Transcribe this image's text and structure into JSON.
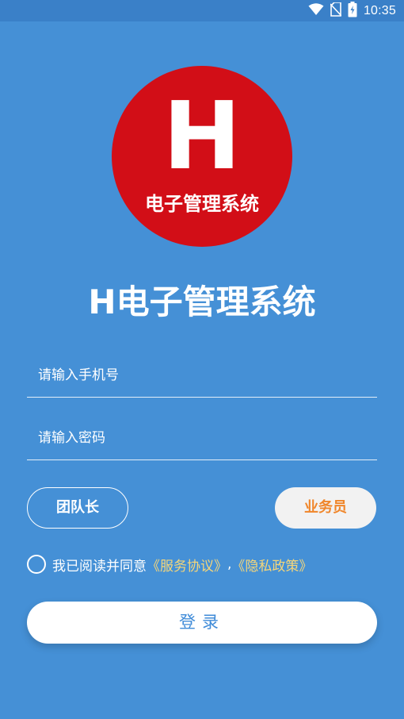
{
  "status_bar": {
    "time": "10:35",
    "icons": [
      "wifi-icon",
      "no-sim-icon",
      "battery-charging-icon"
    ]
  },
  "logo": {
    "letter": "H",
    "text": "电子管理系统",
    "color": "#d20e17"
  },
  "app_title": "H电子管理系统",
  "form": {
    "phone_placeholder": "请输入手机号",
    "phone_value": "",
    "password_placeholder": "请输入密码",
    "password_value": ""
  },
  "roles": {
    "leader_label": "团队长",
    "staff_label": "业务员",
    "selected": "业务员"
  },
  "agreement": {
    "checked": false,
    "prefix": "我已阅读并同意",
    "service_link": "《服务协议》",
    "separator": ",",
    "privacy_link": "《隐私政策》"
  },
  "login_label": "登录",
  "colors": {
    "background": "#4590d6",
    "accent_orange": "#f0862a",
    "link_yellow": "#f5d67a"
  }
}
